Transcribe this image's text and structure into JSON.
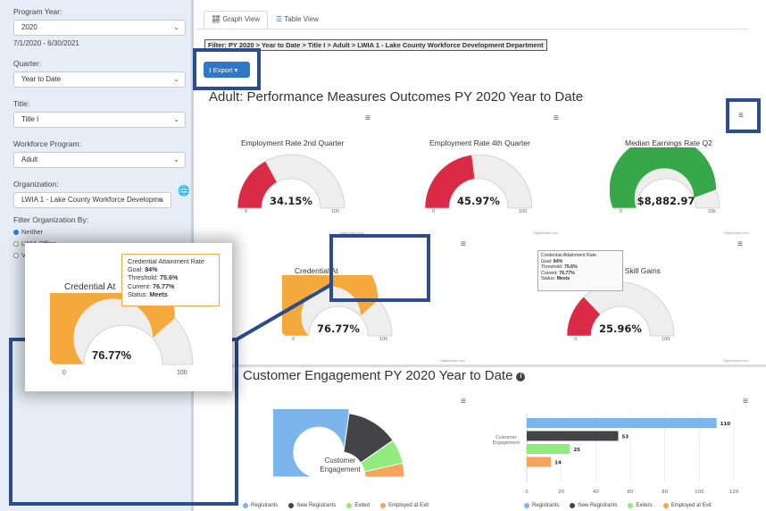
{
  "sidebar": {
    "program_year_label": "Program Year:",
    "program_year_value": "2020",
    "program_year_range": "7/1/2020 - 6/30/2021",
    "quarter_label": "Quarter:",
    "quarter_value": "Year to Date",
    "title_label": "Title:",
    "title_value": "Title I",
    "workforce_program_label": "Workforce Program:",
    "workforce_program_value": "Adult",
    "organization_label": "Organization:",
    "organization_value": "LWIA 1 - Lake County Workforce Developme",
    "filter_org_label": "Filter Organization By:",
    "filter_options": [
      "Neither",
      "LWIA Office",
      "V"
    ]
  },
  "tabs": {
    "graph": "Graph View",
    "table": "Table View"
  },
  "filter_bar": "Filter: PY 2020 > Year to Date > Title I > Adult > LWIA 1 - Lake County Workforce Development Department",
  "export_label": "Export",
  "performance": {
    "title": "Adult: Performance Measures Outcomes PY 2020 Year to Date",
    "gauges": [
      {
        "title": "Employment Rate 2nd Quarter",
        "value_text": "34.15%",
        "value": 34.15,
        "max": 100,
        "min_label": "0",
        "max_label": "100",
        "color": "#d92b45"
      },
      {
        "title": "Employment Rate 4th Quarter",
        "value_text": "45.97%",
        "value": 45.97,
        "max": 100,
        "min_label": "0",
        "max_label": "100",
        "color": "#d92b45"
      },
      {
        "title": "Median Earnings Rate Q2",
        "value_text": "$8,882.97",
        "value": 8882.97,
        "max": 10000,
        "min_label": "0",
        "max_label": "10k",
        "color": "#37a849"
      },
      {
        "title": "Credential At",
        "value_text": "76.77%",
        "value": 76.77,
        "max": 100,
        "min_label": "0",
        "max_label": "100",
        "color": "#f5a83b"
      },
      {
        "title": "Measurable Skill Gains",
        "value_text": "25.96%",
        "value": 25.96,
        "max": 100,
        "min_label": "0",
        "max_label": "100",
        "color": "#d92b45"
      }
    ],
    "credit": "Highcharts.com"
  },
  "tooltip": {
    "title": "Credential Attainment Rate",
    "goal_label": "Goal:",
    "goal": "84%",
    "threshold_label": "Threshold:",
    "threshold": "75.6%",
    "current_label": "Current:",
    "current": "76.77%",
    "status_label": "Status:",
    "status": "Meets"
  },
  "zoom": {
    "title": "Credential At",
    "value_text": "76.77%",
    "min_label": "0",
    "max_label": "100"
  },
  "engagement": {
    "title": "Customer Engagement PY 2020 Year to Date",
    "info_icon": "i",
    "donut_label_line1": "Customer",
    "donut_label_line2": "Engagement",
    "legend_left": [
      "Registrants",
      "New Registrants",
      "Exited",
      "Employed at Exit"
    ],
    "legend_right": [
      "Registrants",
      "New Registrants",
      "Exiters",
      "Employed at Exit"
    ]
  },
  "colors": {
    "blue": "#7cb5ec",
    "dark": "#434348",
    "green": "#90ed7d",
    "orange": "#f7a35c",
    "highlight": "#2b4d8e"
  },
  "chart_data": [
    {
      "type": "pie",
      "categories": [
        "Registrants",
        "New Registrants",
        "Exited",
        "Employed at Exit"
      ],
      "values": [
        110,
        53,
        25,
        14
      ],
      "title": "Customer Engagement"
    },
    {
      "type": "bar",
      "categories": [
        "Customer Engagement"
      ],
      "series": [
        {
          "name": "Registrants",
          "values": [
            110
          ]
        },
        {
          "name": "New Registrants",
          "values": [
            53
          ]
        },
        {
          "name": "Exiters",
          "values": [
            25
          ]
        },
        {
          "name": "Employed at Exit",
          "values": [
            14
          ]
        }
      ],
      "data_labels": [
        "110",
        "53",
        "25",
        "14"
      ],
      "x_ticks": [
        "0",
        "20",
        "40",
        "60",
        "80",
        "100",
        "120"
      ],
      "xlim": [
        0,
        120
      ],
      "ylabel": "Customer Engagement"
    }
  ]
}
